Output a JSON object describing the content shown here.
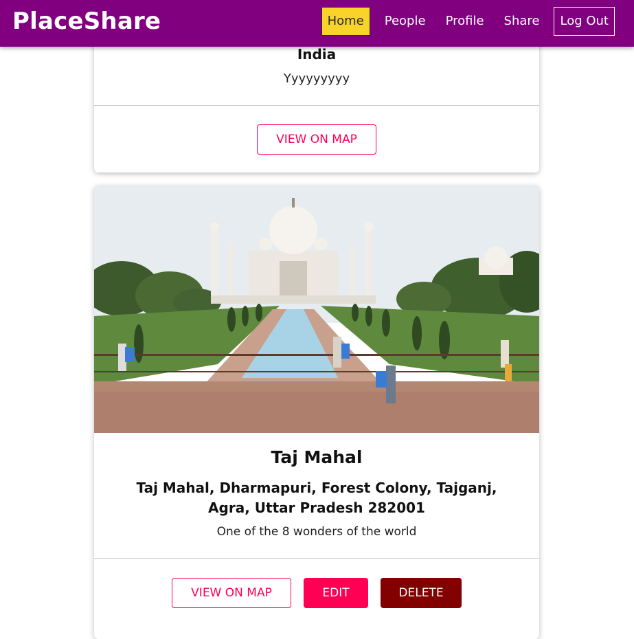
{
  "header": {
    "logo": "PlaceShare",
    "nav": {
      "home": "Home",
      "people": "People",
      "profile": "Profile",
      "share": "Share",
      "logout": "Log Out"
    }
  },
  "places": [
    {
      "address": "India",
      "description": "Yyyyyyyyy",
      "view_on_map": "VIEW ON MAP"
    },
    {
      "title": "Taj Mahal",
      "address": "Taj Mahal, Dharmapuri, Forest Colony, Tajganj, Agra, Uttar Pradesh 282001",
      "description": "One of the 8 wonders of the world",
      "view_on_map": "VIEW ON MAP",
      "edit": "EDIT",
      "delete": "DELETE"
    }
  ],
  "colors": {
    "header_bg": "#800080",
    "active_nav": "#f8d42a",
    "accent": "#ff0055",
    "danger": "#830000"
  }
}
